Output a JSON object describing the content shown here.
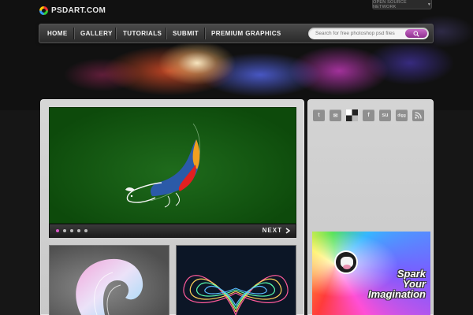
{
  "site": {
    "logo_text": "PSDART.COM",
    "network_label": "OPEN SOURCE NETWORK"
  },
  "nav": {
    "items": [
      {
        "label": "HOME"
      },
      {
        "label": "GALLERY"
      },
      {
        "label": "TUTORIALS"
      },
      {
        "label": "SUBMIT"
      },
      {
        "label": "PREMIUM GRAPHICS"
      }
    ]
  },
  "search": {
    "placeholder": "Search for free photoshop psd files"
  },
  "slider": {
    "dot_count": 5,
    "active_dot": 1,
    "next_label": "NEXT"
  },
  "social": {
    "icons": [
      "twitter-icon",
      "email-icon",
      "delicious-icon",
      "facebook-icon",
      "stumbleupon-icon",
      "digg-icon",
      "rss-icon"
    ]
  },
  "ad": {
    "headline_line1": "Spark",
    "headline_line2": "Your",
    "headline_line3": "Imagination"
  },
  "colors": {
    "accent": "#b04ab0",
    "slide_green": "#135c11",
    "nav_bg": "#3a3a3a"
  }
}
